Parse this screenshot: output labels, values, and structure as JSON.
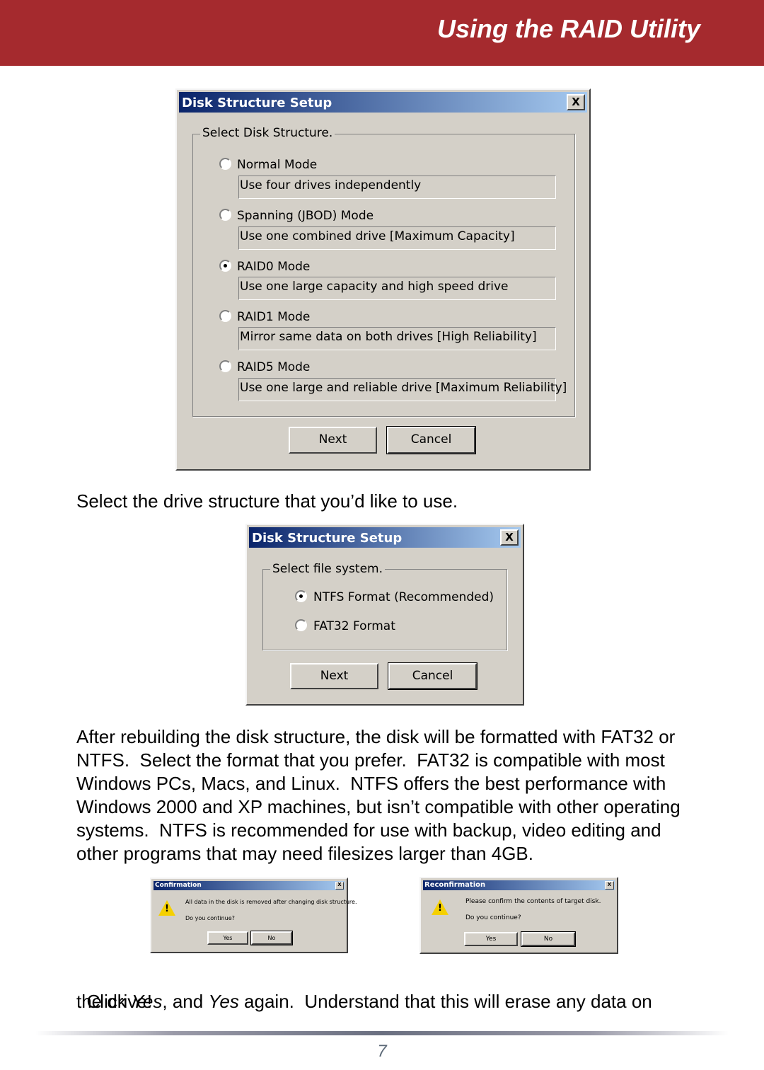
{
  "header": {
    "title": "Using the RAID Utility",
    "color": "#a52a2e"
  },
  "dialog1": {
    "title": "Disk Structure Setup",
    "group_label": "Select Disk Structure.",
    "options": [
      {
        "label": "Normal Mode",
        "description": "Use four drives independently",
        "selected": false
      },
      {
        "label": "Spanning (JBOD) Mode",
        "description": "Use one combined drive [Maximum Capacity]",
        "selected": false
      },
      {
        "label": "RAID0 Mode",
        "description": "Use one large capacity and high speed drive",
        "selected": true
      },
      {
        "label": "RAID1 Mode",
        "description": "Mirror same data on both drives [High Reliability]",
        "selected": false
      },
      {
        "label": "RAID5 Mode",
        "description": "Use one large and reliable drive [Maximum Reliability]",
        "selected": false
      }
    ],
    "next": "Next",
    "cancel": "Cancel",
    "close": "X"
  },
  "caption1": "Select the drive structure that you’d like to use.",
  "dialog2": {
    "title": "Disk Structure Setup",
    "group_label": "Select file system.",
    "options": [
      {
        "label": "NTFS Format (Recommended)",
        "selected": true
      },
      {
        "label": "FAT32 Format",
        "selected": false
      }
    ],
    "next": "Next",
    "cancel": "Cancel",
    "close": "X"
  },
  "paragraph": [
    "After rebuilding the disk structure, the disk will be formatted with FAT32 or",
    "NTFS.  Select the format that you prefer.  FAT32 is compatible with most",
    "Windows PCs, Macs, and Linux.  NTFS offers the best performance with",
    "Windows 2000 and XP machines, but isn’t compatible with other operating",
    "systems.  NTFS is recommended for use with backup, video editing and",
    "other programs that may need filesizes larger than 4GB."
  ],
  "confirm": {
    "title": "Confirmation",
    "message": "All data in the disk is removed after changing disk structure.",
    "question": "Do you continue?",
    "yes": "Yes",
    "no": "No",
    "close": "X"
  },
  "reconfirm": {
    "title": "Reconfirmation",
    "message": "Please confirm the contents of target disk.",
    "question": "Do you continue?",
    "yes": "Yes",
    "no": "No",
    "close": "X"
  },
  "caption2": {
    "p1": "Click ",
    "yes1": "Yes",
    "p2": ", and ",
    "yes2": "Yes",
    "p3": " again.  Understand that this will erase any data on",
    "line2": "the drive!"
  },
  "page_number": "7"
}
